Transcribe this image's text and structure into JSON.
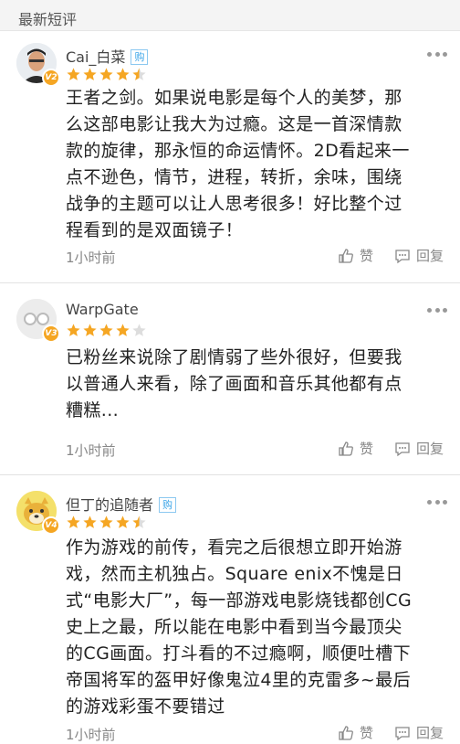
{
  "section": {
    "title": "最新短评"
  },
  "reviews": [
    {
      "username": "Cai_白菜",
      "level": "V2",
      "buy_tag": "购",
      "stars": 4.5,
      "content_lines": [
        "王者之剑。如果说电影是每个人的美梦，那",
        "么这部电影让我大为过瘾。这是一首深情款",
        "款的旋律，那永恒的命运情怀。2D看起来一",
        "点不逊色，情节，进程，转折，余味，围绕",
        "战争的主题可以让人思考很多！好比整个过",
        "程看到的是双面镜子！"
      ],
      "time": "1小时前",
      "like_label": "赞",
      "reply_label": "回复"
    },
    {
      "username": "WarpGate",
      "level": "V3",
      "buy_tag": "",
      "stars": 4,
      "content_lines": [
        "已粉丝来说除了剧情弱了些外很好，但要我",
        "以普通人来看，除了画面和音乐其他都有点",
        "糟糕..."
      ],
      "time": "1小时前",
      "like_label": "赞",
      "reply_label": "回复"
    },
    {
      "username": "但丁的追随者",
      "level": "V4",
      "buy_tag": "购",
      "stars": 4.5,
      "content_lines": [
        "作为游戏的前传，看完之后很想立即开始游",
        "戏，然而主机独占。Square enix不愧是日",
        "式“电影大厂”，每一部游戏电影烧钱都创CG",
        "史上之最，所以能在电影中看到当今最顶尖",
        "的CG画面。打斗看的不过瘾啊，顺便吐槽下",
        "帝国将军的盔甲好像鬼泣4里的克雷多~最后",
        "的游戏彩蛋不要错过"
      ],
      "time": "1小时前",
      "like_label": "赞",
      "reply_label": "回复"
    }
  ],
  "colors": {
    "star": "#f5a623",
    "star_empty": "#dddddd",
    "buy_tag": "#3ba5e8",
    "badge": "#f5a623"
  },
  "icons": {
    "more": "more-dots-icon",
    "like": "thumbs-up-icon",
    "reply": "comment-icon"
  }
}
